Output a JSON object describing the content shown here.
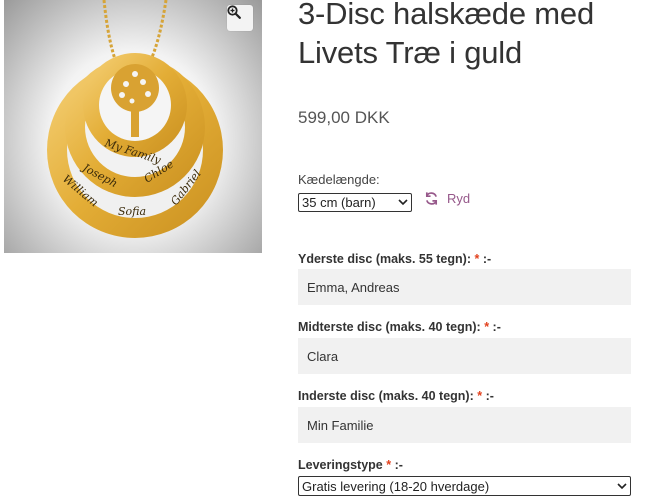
{
  "product": {
    "title_line1": "3-Disc halskæde med",
    "title_line2": "Livets Træ i guld",
    "price": "599,00 DKK",
    "image": {
      "engraving_center": "My Family",
      "engraving_middle": [
        "Joseph",
        "Chloe"
      ],
      "engraving_outer": [
        "William",
        "Sofia",
        "Gabriel"
      ],
      "zoom_icon": "zoom-in-icon"
    }
  },
  "chain": {
    "label": "Kædelængde:",
    "selected": "35 cm (barn)",
    "reset_label": "Ryd",
    "reset_icon": "refresh-icon"
  },
  "fields": [
    {
      "label": "Yderste disc (maks. 55 tegn):",
      "required_mark": "*",
      "suffix": " :-",
      "value": "Emma, Andreas"
    },
    {
      "label": "Midterste disc (maks. 40 tegn):",
      "required_mark": "*",
      "suffix": " :-",
      "value": "Clara"
    },
    {
      "label": "Inderste disc (maks. 40 tegn):",
      "required_mark": "*",
      "suffix": " :-",
      "value": "Min Familie"
    }
  ],
  "delivery": {
    "label": "Leveringstype",
    "required_mark": "*",
    "suffix": " :-",
    "selected": "Gratis levering (18-20 hverdage)"
  },
  "colors": {
    "accent": "#96588a",
    "required": "#e2401c",
    "gold": "#e9b53c",
    "field_bg": "#f1f1f1"
  }
}
